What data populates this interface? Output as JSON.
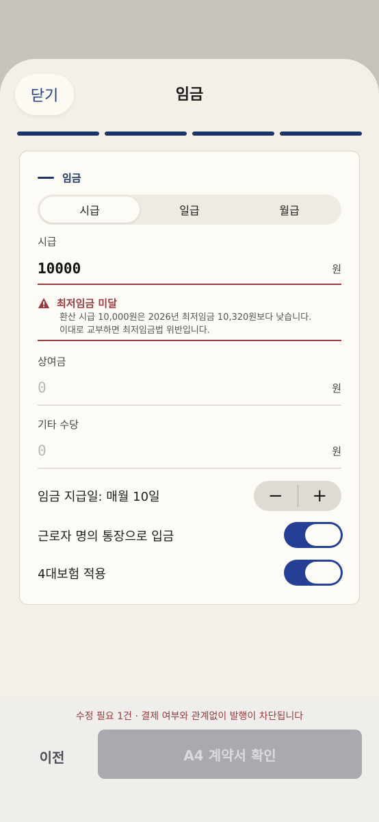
{
  "header": {
    "close_label": "닫기",
    "title": "임금"
  },
  "progress": {
    "total_steps": 4,
    "completed_steps": 4
  },
  "section": {
    "title": "임금"
  },
  "wage_type": {
    "options": [
      "시급",
      "일급",
      "월급"
    ],
    "selected": "시급"
  },
  "fields": {
    "hourly": {
      "label": "시급",
      "value": "10000",
      "unit": "원"
    },
    "bonus": {
      "label": "상여금",
      "placeholder": "0",
      "unit": "원"
    },
    "allowance": {
      "label": "기타 수당",
      "placeholder": "0",
      "unit": "원"
    }
  },
  "alert": {
    "title": "최저임금 미달",
    "line1": "환산 시급 10,000원은 2026년 최저임금 10,320원보다 낮습니다.",
    "line2": "이대로 교부하면 최저임금법 위반입니다.",
    "color": "#9a3a3f"
  },
  "payday": {
    "label": "임금 지급일: 매월 10일",
    "minus": "−",
    "plus": "+"
  },
  "toggles": {
    "bank_deposit": {
      "label": "근로자 명의 통장으로 입금",
      "on": true
    },
    "insurance": {
      "label": "4대보험 적용",
      "on": true
    }
  },
  "footer": {
    "warning": "수정 필요 1건 · 결제 여부와 관계없이 발행이 차단됩니다",
    "prev_label": "이전",
    "confirm_label": "A4 계약서 확인",
    "confirm_disabled": true
  },
  "colors": {
    "accent": "#253f95",
    "navy": "#1a3466",
    "error": "#9a3a3f",
    "background": "#f4efe7"
  }
}
